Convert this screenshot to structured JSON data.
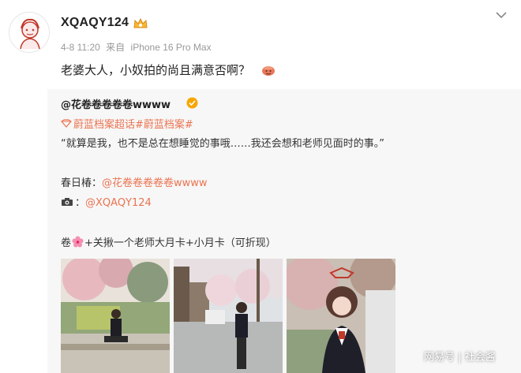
{
  "post": {
    "username": "XQAQY124",
    "meta": {
      "date": "4-8 11:20",
      "source_prefix": "来自",
      "device": "iPhone 16 Pro Max"
    },
    "text": "老婆大人，小奴拍的尚且满意否啊？"
  },
  "repost": {
    "user": "@花卷卷卷卷卷wwww",
    "topics": "蔚蓝档案超话#蔚蓝档案#",
    "quote": "“就算是我，也不是总在想睡觉的事哦……我还会想和老师见面时的事。”",
    "character_label": "春日椿：",
    "character_link": "@花卷卷卷卷卷wwww",
    "photographer_link": "@XQAQY124",
    "cos_prefix": "卷",
    "cos_suffix": "+关揪一个老师大月卡+小月卡（可折现）"
  },
  "watermark": "网易号 | 社会酱",
  "colors": {
    "link": "#eb7350",
    "card_bg": "#f7f7f7",
    "meta": "#999999"
  },
  "icons": [
    "vip-crown-icon",
    "chevron-down-icon",
    "emoji-icon",
    "verified-icon",
    "topic-icon",
    "camera-icon",
    "flower-icon"
  ]
}
